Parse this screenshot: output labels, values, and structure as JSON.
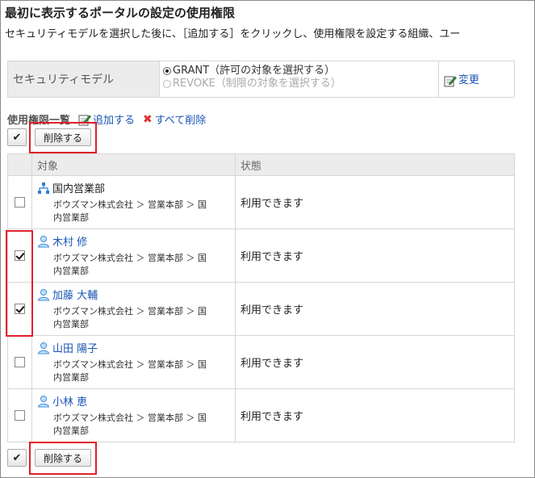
{
  "page": {
    "title": "最初に表示するポータルの設定の使用権限",
    "description": "セキュリティモデルを選択した後に、［追加する］をクリックし、使用権限を設定する組織、ユー"
  },
  "security": {
    "label": "セキュリティモデル",
    "grant_label": "GRANT（許可の対象を選択する）",
    "revoke_label": "REVOKE（制限の対象を選択する）",
    "selected": "GRANT",
    "change_label": "変更"
  },
  "permissions": {
    "title": "使用権限一覧",
    "add_label": "追加する",
    "delete_all_label": "すべて削除"
  },
  "toolbar": {
    "check_all_glyph": "✔",
    "delete_label": "削除する"
  },
  "table": {
    "headers": {
      "target": "対象",
      "status": "状態"
    },
    "rows": [
      {
        "type": "org",
        "name": "国内営業部",
        "path_line1": "ボウズマン株式会社 ＞ 営業本部 ＞ 国",
        "path_line2": "内営業部",
        "status": "利用できます",
        "checked": false
      },
      {
        "type": "user",
        "name": "木村 修",
        "path_line1": "ボウズマン株式会社 ＞ 営業本部 ＞ 国",
        "path_line2": "内営業部",
        "status": "利用できます",
        "checked": true
      },
      {
        "type": "user",
        "name": "加藤 大輔",
        "path_line1": "ボウズマン株式会社 ＞ 営業本部 ＞ 国",
        "path_line2": "内営業部",
        "status": "利用できます",
        "checked": true
      },
      {
        "type": "user",
        "name": "山田 陽子",
        "path_line1": "ボウズマン株式会社 ＞ 営業本部 ＞ 国",
        "path_line2": "内営業部",
        "status": "利用できます",
        "checked": false
      },
      {
        "type": "user",
        "name": "小林 恵",
        "path_line1": "ボウズマン株式会社 ＞ 営業本部 ＞ 国",
        "path_line2": "内営業部",
        "status": "利用できます",
        "checked": false
      }
    ]
  },
  "colors": {
    "highlight": "#e0202a",
    "link": "#1a55b5",
    "header_bg": "#ececec"
  }
}
